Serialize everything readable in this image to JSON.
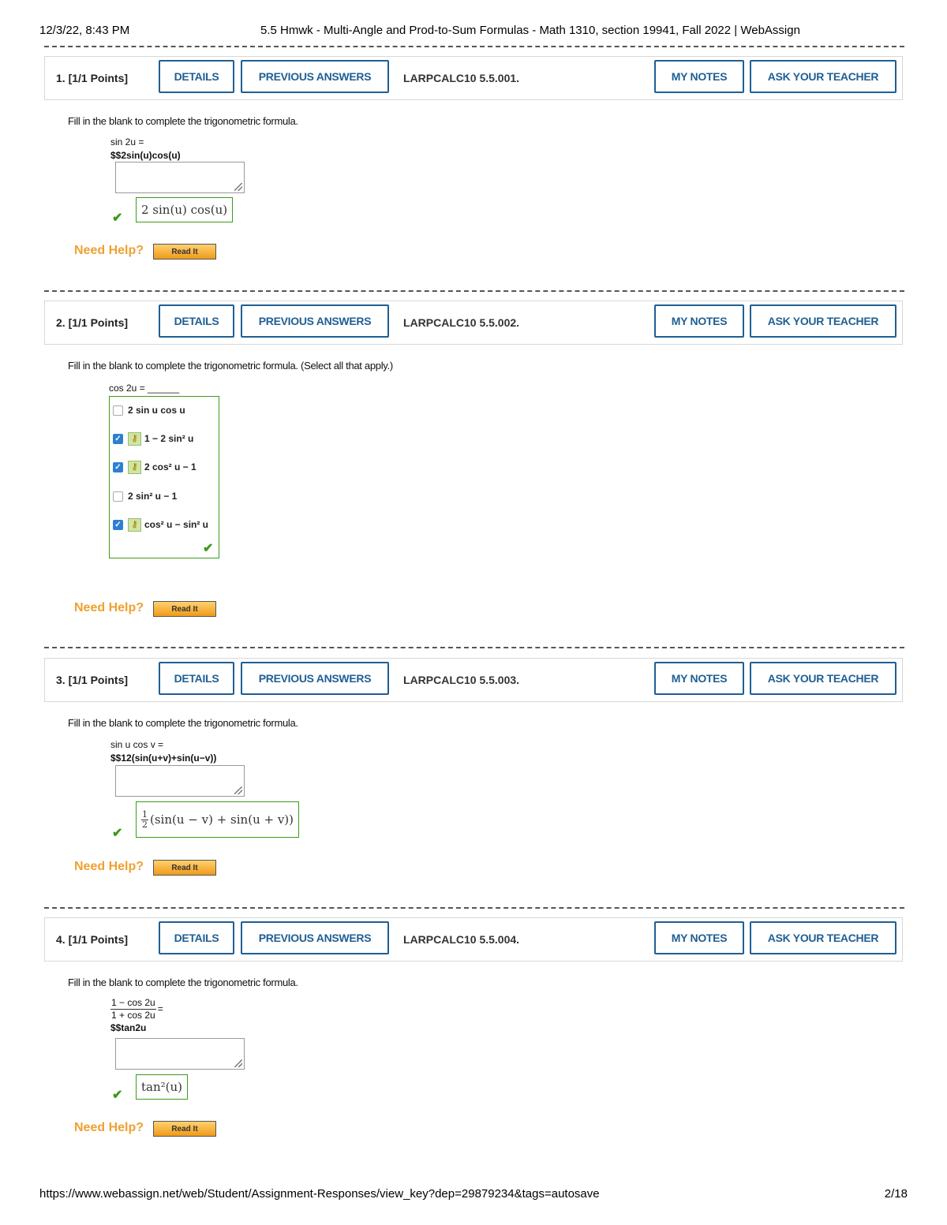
{
  "header": {
    "datetime": "12/3/22, 8:43 PM",
    "page_title": "5.5 Hmwk - Multi-Angle and Prod-to-Sum Formulas - Math 1310, section 19941, Fall 2022 | WebAssign"
  },
  "buttons": {
    "details": "DETAILS",
    "previous_answers": "PREVIOUS ANSWERS",
    "my_notes": "MY NOTES",
    "ask_teacher": "ASK YOUR TEACHER",
    "read_it": "Read It"
  },
  "need_help": "Need Help?",
  "questions": [
    {
      "number": "1.",
      "points": "[1/1 Points]",
      "ref": "LARPCALC10 5.5.001.",
      "prompt": "Fill in the blank to complete the trigonometric formula.",
      "formula_line1": "sin 2u =",
      "formula_line2": "$$2sin(u)cos(u)",
      "correct_answer": "2 sin(u) cos(u)"
    },
    {
      "number": "2.",
      "points": "[1/1 Points]",
      "ref": "LARPCALC10 5.5.002.",
      "prompt": "Fill in the blank to complete the trigonometric formula. (Select all that apply.)",
      "formula_line1": "cos 2u = ______",
      "choices": [
        {
          "label": "2 sin u cos u",
          "checked": false
        },
        {
          "label": "1 − 2 sin² u",
          "checked": true
        },
        {
          "label": "2 cos² u − 1",
          "checked": true
        },
        {
          "label": "2 sin² u − 1",
          "checked": false
        },
        {
          "label": "cos² u − sin² u",
          "checked": true
        }
      ]
    },
    {
      "number": "3.",
      "points": "[1/1 Points]",
      "ref": "LARPCALC10 5.5.003.",
      "prompt": "Fill in the blank to complete the trigonometric formula.",
      "formula_line1": "sin u cos v =",
      "formula_line2": "$$12(sin(u+v)+sin(u−v))",
      "correct_answer": "(sin(u − v) + sin(u + v))",
      "correct_fraction": {
        "num": "1",
        "den": "2"
      }
    },
    {
      "number": "4.",
      "points": "[1/1 Points]",
      "ref": "LARPCALC10 5.5.004.",
      "prompt": "Fill in the blank to complete the trigonometric formula.",
      "formula_num": "1 − cos 2u",
      "formula_den": "1 + cos 2u",
      "formula_eq": "=",
      "formula_line2": "$$tan2u",
      "correct_answer": "tan²(u)"
    }
  ],
  "footer": {
    "url": "https://www.webassign.net/web/Student/Assignment-Responses/view_key?dep=29879234&tags=autosave",
    "page": "2/18"
  },
  "colors": {
    "button_blue": "#1f5f94",
    "correct_green": "#3a9b1a",
    "need_help_orange": "#f0a030"
  }
}
